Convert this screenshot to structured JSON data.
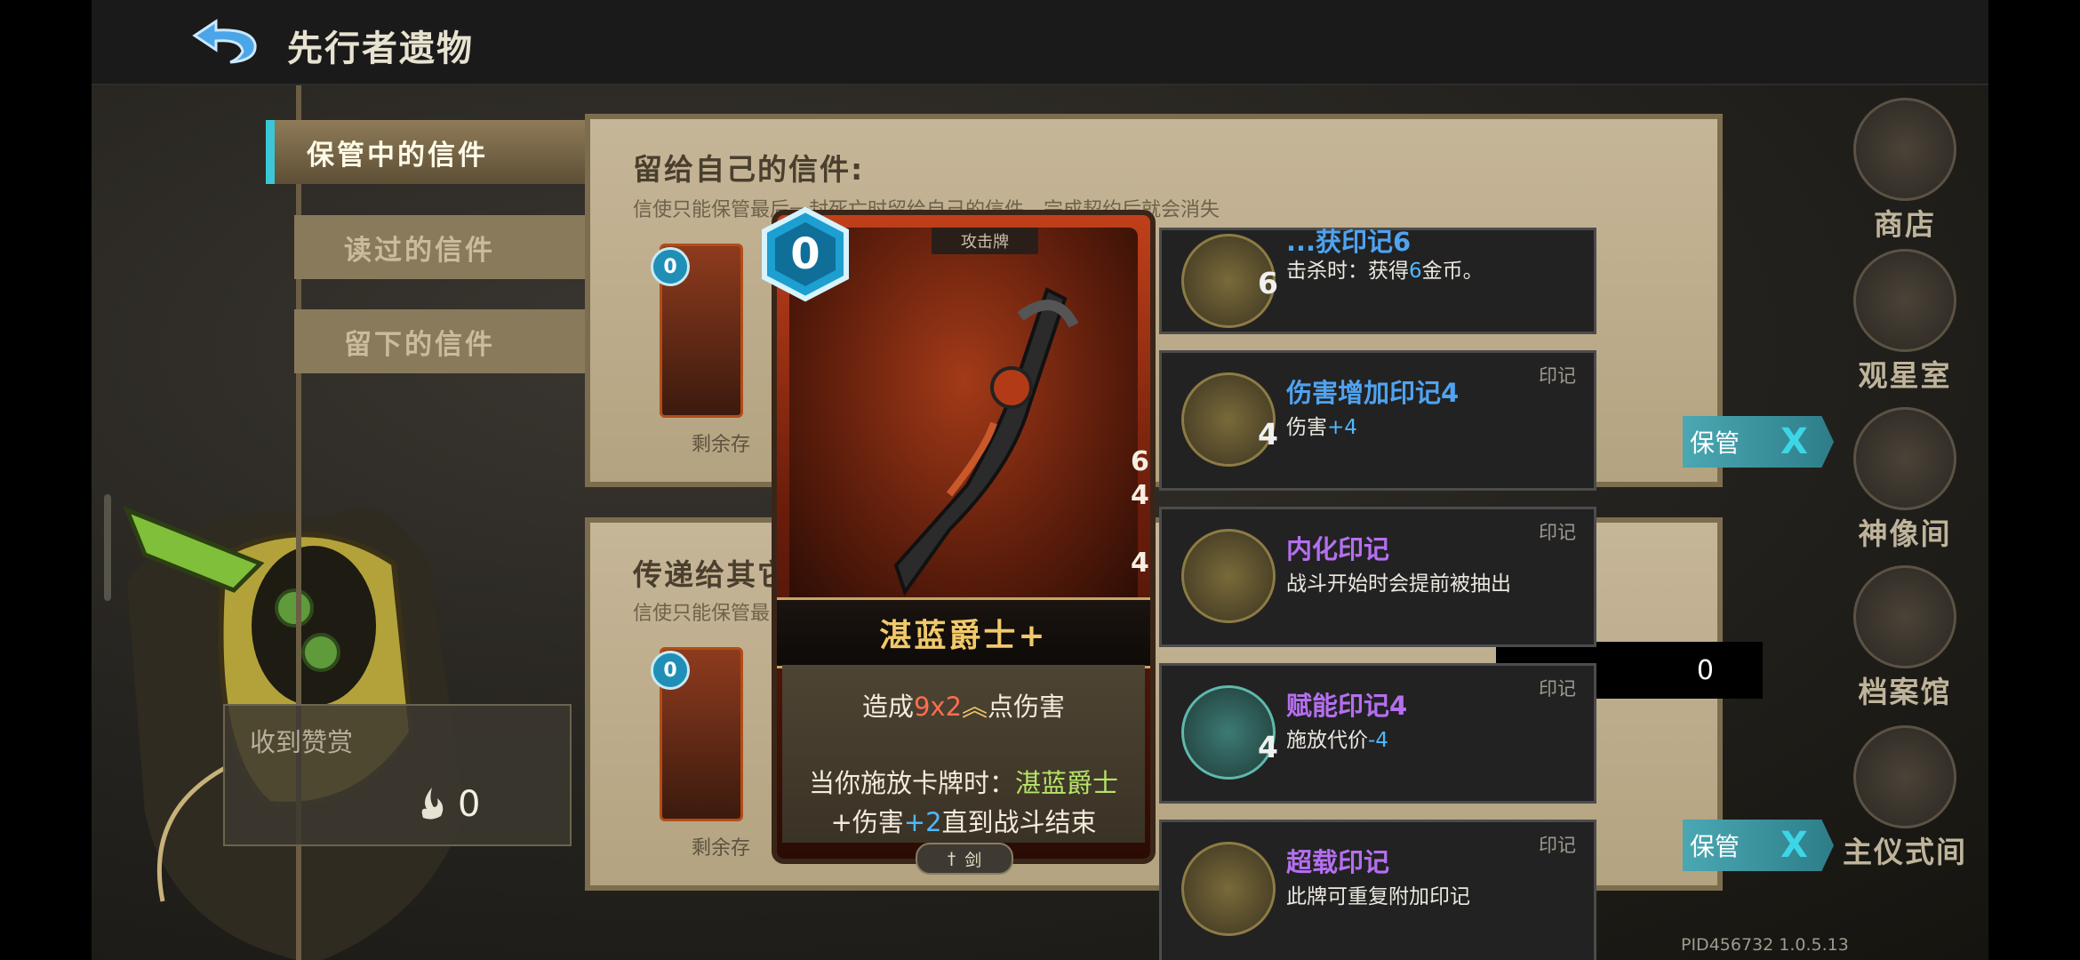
{
  "header": {
    "title": "先行者遗物",
    "back_icon": "back-arrow-icon"
  },
  "tabs": [
    {
      "label": "保管中的信件",
      "active": true
    },
    {
      "label": "读过的信件",
      "active": false
    },
    {
      "label": "留下的信件",
      "active": false
    }
  ],
  "panel_self": {
    "title": "留给自己的信件:",
    "subtitle": "信使只能保管最后一封死亡时留给自己的信件，完成契约后就会消失",
    "remain_label": "剩余存",
    "mini_cost": "0",
    "keep_label": "保管",
    "keep_x": "X"
  },
  "panel_other": {
    "title": "传递给其它",
    "subtitle": "信使只能保管最",
    "remain_label": "剩余存",
    "mini_cost": "0",
    "keep_label": "保管",
    "keep_x": "X",
    "count_value": "0"
  },
  "reward": {
    "label": "收到赞赏",
    "value": "0"
  },
  "right_nav": [
    {
      "label": "商店"
    },
    {
      "label": "观星室"
    },
    {
      "label": "神像间"
    },
    {
      "label": "档案馆"
    },
    {
      "label": "主仪式间"
    }
  ],
  "card": {
    "cost": "0",
    "top_label": "攻击牌",
    "name": "湛蓝爵士+",
    "desc_line1": {
      "prefix": "造成",
      "damage": "9x2",
      "suffix": "点伤害"
    },
    "desc_line2": {
      "prefix": "当你施放卡牌时：",
      "card_ref": "湛蓝爵士"
    },
    "desc_line3": {
      "prefix": "+伤害",
      "bonus": "+2",
      "suffix": "直到战斗结束"
    },
    "type": "剑",
    "side_numbers": [
      "6",
      "4",
      "4"
    ]
  },
  "tooltips": [
    {
      "title": "...获印记6",
      "desc_prefix": "击杀时：获得",
      "desc_value": "6",
      "desc_suffix": "金币。",
      "level": "6",
      "tag": "",
      "title_color": "#4fa3f0"
    },
    {
      "title": "伤害增加印记4",
      "desc_prefix": "伤害",
      "desc_value": "+4",
      "desc_suffix": "",
      "level": "4",
      "tag": "印记",
      "title_color": "#4fa3f0"
    },
    {
      "title": "内化印记",
      "desc_prefix": "战斗开始时会提前被抽出",
      "desc_value": "",
      "desc_suffix": "",
      "level": "",
      "tag": "印记",
      "title_color": "#b56ff0"
    },
    {
      "title": "赋能印记4",
      "desc_prefix": "施放代价",
      "desc_value": "-4",
      "desc_suffix": "",
      "level": "4",
      "tag": "印记",
      "title_color": "#b56ff0"
    },
    {
      "title": "超载印记",
      "desc_prefix": "此牌可重复附加印记",
      "desc_value": "",
      "desc_suffix": "",
      "level": "",
      "tag": "印记",
      "title_color": "#b56ff0"
    }
  ],
  "version": "PID456732  1.0.5.13"
}
